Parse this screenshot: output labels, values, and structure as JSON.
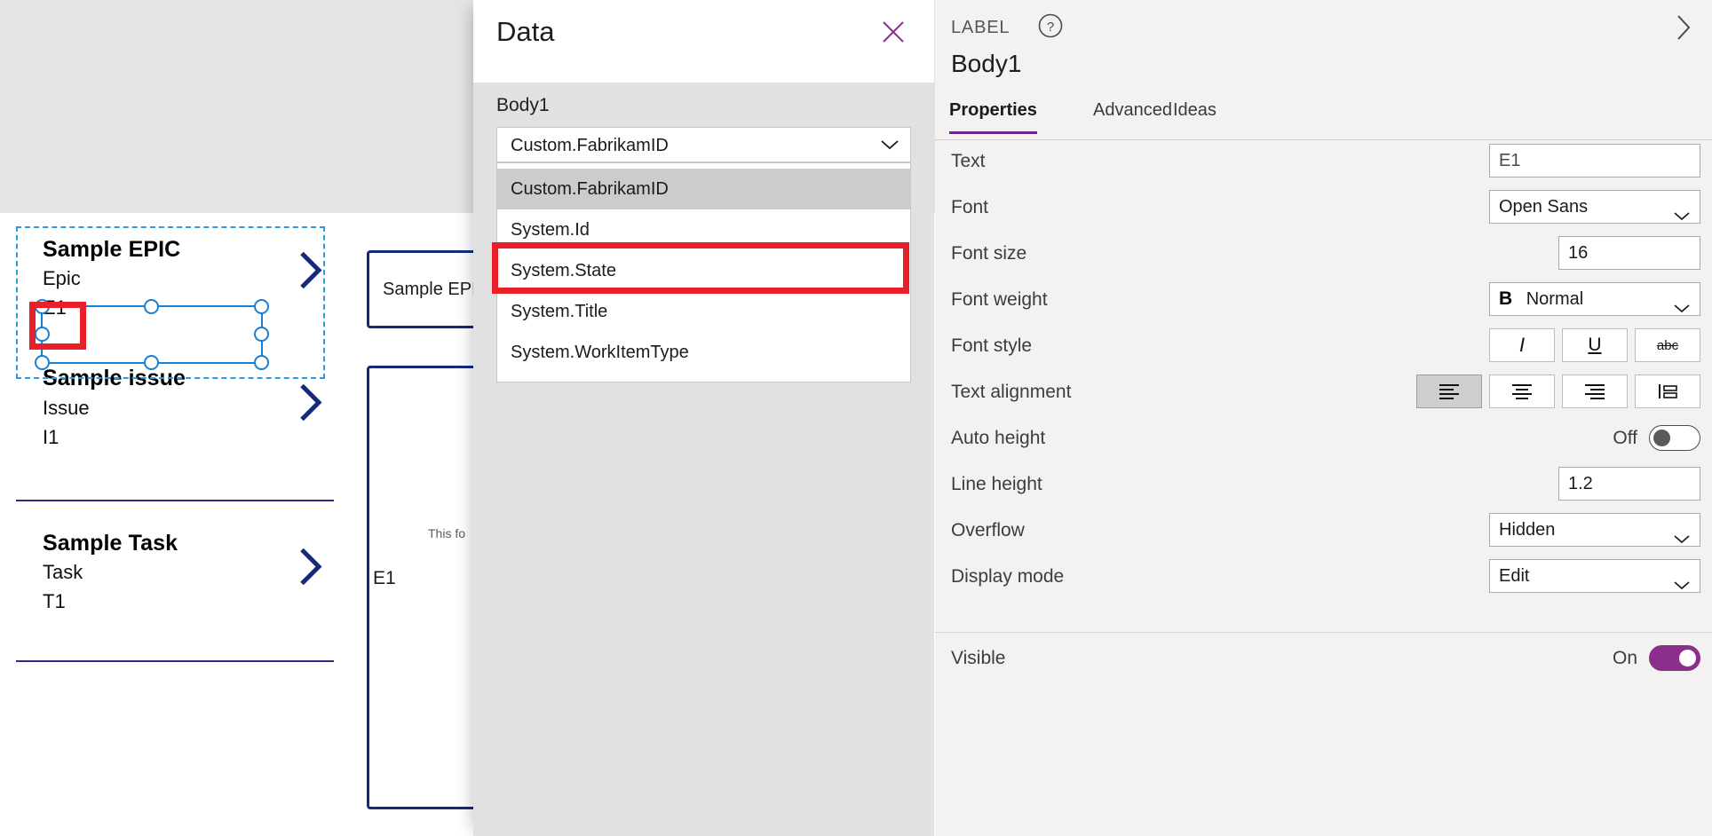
{
  "canvas": {
    "gallery": {
      "items": [
        {
          "title": "Sample EPIC",
          "type": "Epic",
          "id": "E1",
          "chevron_icon": "chevron-right-icon"
        },
        {
          "title": "Sample issue",
          "type": "Issue",
          "id": "I1",
          "chevron_icon": "chevron-right-icon"
        },
        {
          "title": "Sample Task",
          "type": "Task",
          "id": "T1",
          "chevron_icon": "chevron-right-icon"
        }
      ]
    },
    "detail_screen": {
      "card_text": "Sample EPIC",
      "note_text": "This fo",
      "id_text": "E1"
    }
  },
  "data_panel": {
    "title": "Data",
    "close_icon": "close-icon",
    "section_label": "Body1",
    "combobox": {
      "value": "Custom.FabrikamID",
      "chevron_icon": "chevron-down-icon"
    },
    "options": [
      {
        "label": "Custom.FabrikamID",
        "selected": true
      },
      {
        "label": "System.Id",
        "selected": false
      },
      {
        "label": "System.State",
        "selected": false
      },
      {
        "label": "System.Title",
        "selected": false
      },
      {
        "label": "System.WorkItemType",
        "selected": false
      }
    ]
  },
  "properties_pane": {
    "control_kind": "LABEL",
    "help_icon": "help-circle-icon",
    "expand_icon": "chevron-right-icon",
    "control_name": "Body1",
    "tabs": [
      {
        "label": "Properties",
        "active": true
      },
      {
        "label": "Advanced",
        "active": false
      },
      {
        "label": "Ideas",
        "active": false
      }
    ],
    "rows": {
      "text": {
        "label": "Text",
        "value": "E1"
      },
      "font": {
        "label": "Font",
        "value": "Open Sans",
        "chevron_icon": "chevron-down-icon"
      },
      "font_size": {
        "label": "Font size",
        "value": "16"
      },
      "font_weight": {
        "label": "Font weight",
        "value": "Normal",
        "bold_icon": "bold-icon",
        "chevron_icon": "chevron-down-icon"
      },
      "font_style": {
        "label": "Font style",
        "buttons": [
          {
            "icon": "italic-icon",
            "glyph": "I",
            "on": false
          },
          {
            "icon": "underline-icon",
            "glyph": "U",
            "on": false
          },
          {
            "icon": "strikethrough-icon",
            "glyph": "abc",
            "on": false
          }
        ]
      },
      "text_alignment": {
        "label": "Text alignment",
        "buttons": [
          {
            "icon": "align-left-icon",
            "on": true
          },
          {
            "icon": "align-center-icon",
            "on": false
          },
          {
            "icon": "align-right-icon",
            "on": false
          },
          {
            "icon": "align-justify-icon",
            "on": false
          }
        ]
      },
      "auto_height": {
        "label": "Auto height",
        "state": "Off",
        "on": false
      },
      "line_height": {
        "label": "Line height",
        "value": "1.2"
      },
      "overflow": {
        "label": "Overflow",
        "value": "Hidden",
        "chevron_icon": "chevron-down-icon"
      },
      "display_mode": {
        "label": "Display mode",
        "value": "Edit",
        "chevron_icon": "chevron-down-icon"
      },
      "visible": {
        "label": "Visible",
        "state": "On",
        "on": true
      }
    }
  },
  "colors": {
    "accent_purple": "#8c2f8c",
    "annotation_red": "#e8202a",
    "selection_blue": "#1b7fd4",
    "gallery_navy": "#162a7d"
  }
}
